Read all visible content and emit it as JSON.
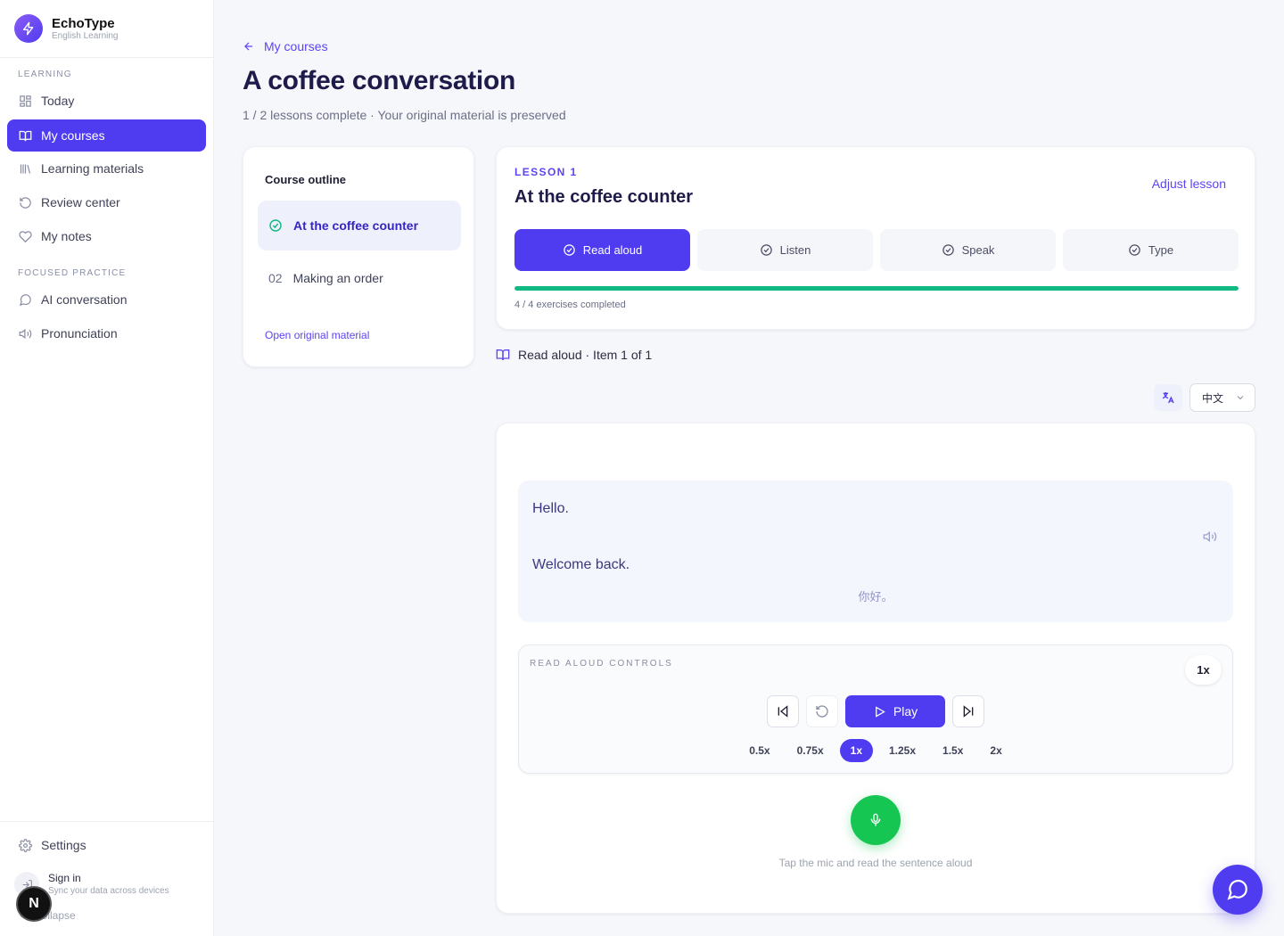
{
  "brand": {
    "name": "EchoType",
    "tagline": "English Learning"
  },
  "sidebar": {
    "sections": [
      {
        "label": "LEARNING"
      },
      {
        "label": "FOCUSED PRACTICE"
      }
    ],
    "items": [
      {
        "label": "Today",
        "icon": "grid-icon"
      },
      {
        "label": "My courses",
        "icon": "book-open-icon",
        "active": true
      },
      {
        "label": "Learning materials",
        "icon": "library-icon"
      },
      {
        "label": "Review center",
        "icon": "rotate-ccw-icon"
      },
      {
        "label": "My notes",
        "icon": "heart-icon"
      },
      {
        "label": "AI conversation",
        "icon": "message-circle-icon"
      },
      {
        "label": "Pronunciation",
        "icon": "volume-icon"
      }
    ],
    "footer": {
      "settings": "Settings",
      "sign_in": "Sign in",
      "sign_in_sub": "Sync your data across devices",
      "collapse": "Collapse"
    }
  },
  "breadcrumb": {
    "back_label": "My courses"
  },
  "page": {
    "title": "A coffee conversation",
    "subtitle": "1 / 2 lessons complete · Your original material is preserved"
  },
  "outline": {
    "title": "Course outline",
    "lessons": [
      {
        "num": "",
        "label": "At the coffee counter",
        "done": true
      },
      {
        "num": "02",
        "label": "Making an order",
        "done": false
      }
    ],
    "open_original": "Open original material"
  },
  "lesson": {
    "kicker": "LESSON 1",
    "title": "At the coffee counter",
    "adjust": "Adjust lesson",
    "modes": [
      "Read aloud",
      "Listen",
      "Speak",
      "Type"
    ],
    "active_mode": 0,
    "progress_fraction": 1.0,
    "progress_text": "4 / 4 exercises completed"
  },
  "item_header": "Read aloud · Item 1 of 1",
  "language": {
    "selected": "中文"
  },
  "exercise": {
    "sentences": [
      "Hello.",
      "Welcome back."
    ],
    "translation": "你好。",
    "controls_label": "READ ALOUD CONTROLS",
    "current_speed": "1x",
    "play_label": "Play",
    "speeds": [
      "0.5x",
      "0.75x",
      "1x",
      "1.25x",
      "1.5x",
      "2x"
    ],
    "active_speed": "1x",
    "mic_hint": "Tap the mic and read the sentence aloud"
  },
  "dev_badge": "N",
  "colors": {
    "accent": "#4f3cf0",
    "success": "#10b981",
    "mic": "#16c653"
  }
}
